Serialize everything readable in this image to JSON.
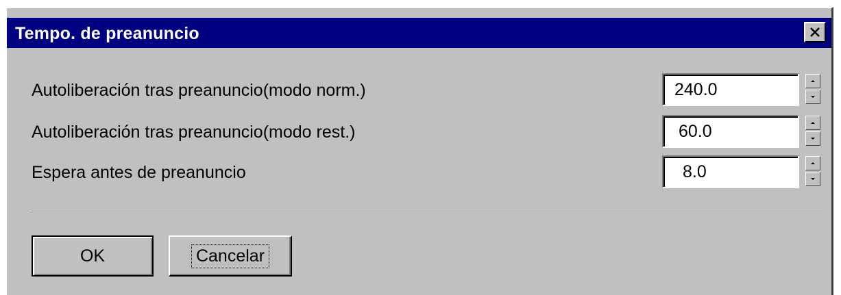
{
  "window": {
    "title": "Tempo. de preanuncio",
    "close_icon": "close-icon"
  },
  "fields": [
    {
      "label": "Autoliberación tras preanuncio(modo norm.)",
      "value": "240.0"
    },
    {
      "label": "Autoliberación tras preanuncio(modo rest.)",
      "value": "60.0"
    },
    {
      "label": "Espera antes de preanuncio",
      "value": "8.0"
    }
  ],
  "buttons": {
    "ok_label": "OK",
    "cancel_label": "Cancelar"
  },
  "colors": {
    "titlebar": "#000080",
    "face": "#c0c0c0"
  }
}
